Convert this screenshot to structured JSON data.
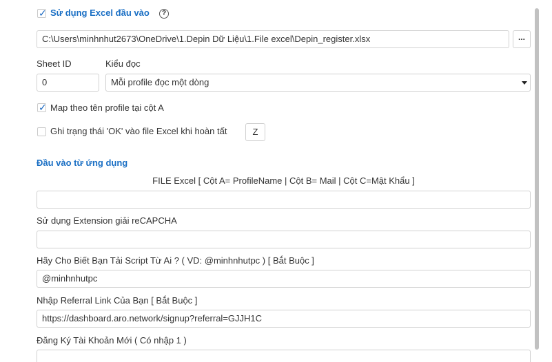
{
  "excel_section": {
    "checkbox_label": "Sử dụng Excel đầu vào",
    "checked": true,
    "file_path": "C:\\Users\\minhnhut2673\\OneDrive\\1.Depin Dữ Liệu\\1.File excel\\Depin_register.xlsx",
    "browse_label": "...",
    "sheet_id_label": "Sheet ID",
    "sheet_id_value": "0",
    "read_mode_label": "Kiểu đọc",
    "read_mode_value": "Mỗi profile đọc một dòng",
    "map_label": "Map theo tên profile tại cột A",
    "map_checked": true,
    "write_status_label": "Ghi trạng thái 'OK' vào file Excel khi hoàn tất",
    "write_status_checked": false,
    "status_column_value": "Z"
  },
  "app_input": {
    "section_title": "Đầu vào từ ứng dụng",
    "file_hint": "FILE Excel [ Cột A= ProfileName | Cột B= Mail | Cột C=Mật Khẩu ]",
    "file_value": "",
    "recaptcha_label": "Sử dụng Extension giải reCAPCHA",
    "recaptcha_value": "",
    "script_source_label": "Hãy Cho Biết Bạn Tải Script Từ Ai ? ( VD: @minhnhutpc ) [ Bắt Buộc ]",
    "script_source_value": "@minhnhutpc",
    "referral_label": "Nhập Referral Link Của Bạn [ Bắt Buộc ]",
    "referral_value": "https://dashboard.aro.network/signup?referral=GJJH1C",
    "register_label": "Đăng Ký Tài Khoản Mới ( Có nhập 1 )"
  },
  "colors": {
    "accent": "#1a6fc4",
    "check": "#1565c0",
    "border": "#d0d0d0"
  },
  "icons": {
    "help": "question-circle-icon",
    "dropdown": "caret-down-icon"
  }
}
